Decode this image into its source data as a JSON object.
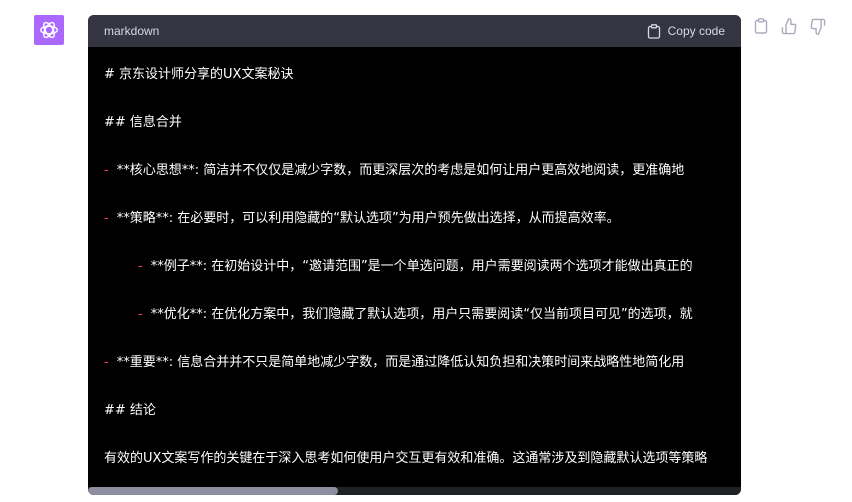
{
  "code_block": {
    "language": "markdown",
    "copy_label": "Copy code",
    "lines": [
      {
        "marker": "",
        "text": "#  京东设计师分享的UX文案秘诀"
      },
      {
        "marker": "",
        "text": "##  信息合并"
      },
      {
        "marker": "-",
        "text": "**核心思想**:  简洁并不仅仅是减少字数，而更深层次的考虑是如何让用户更高效地阅读，更准确地"
      },
      {
        "marker": "-",
        "text": "**策略**:  在必要时，可以利用隐藏的“默认选项”为用户预先做出选择，从而提高效率。"
      },
      {
        "marker": "-",
        "text": "**例子**:  在初始设计中，“邀请范围”是一个单选问题，用户需要阅读两个选项才能做出真正的"
      },
      {
        "marker": "-",
        "text": "**优化**:  在优化方案中，我们隐藏了默认选项，用户只需要阅读“仅当前项目可见”的选项，就"
      },
      {
        "marker": "-",
        "text": "**重要**:  信息合并并不只是简单地减少字数，而是通过降低认知负担和决策时间来战略性地简化用"
      },
      {
        "marker": "",
        "text": "##  结论"
      },
      {
        "marker": "",
        "text": "有效的UX文案写作的关键在于深入思考如何使用户交互更有效和准确。这通常涉及到隐藏默认选项等策略"
      }
    ]
  },
  "colors": {
    "avatar_bg": "#ab68ff",
    "code_bg": "#000000",
    "header_bg": "#343541",
    "bullet": "#ef4146"
  },
  "icons": {
    "avatar": "openai-logo-icon",
    "copy": "clipboard-icon",
    "actions": [
      "clipboard-icon",
      "thumbs-up-icon",
      "thumbs-down-icon"
    ]
  }
}
